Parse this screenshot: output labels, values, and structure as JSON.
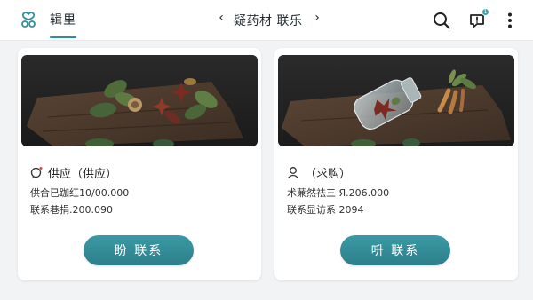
{
  "app": {
    "tab_label": "辑里",
    "accent": "#2f8f9a"
  },
  "nav": {
    "prev_symbol": "‹",
    "title": "疑药材 联乐",
    "next_symbol": "›"
  },
  "toolbar": {
    "search_icon": "search-icon",
    "message_icon": "message-icon",
    "message_badge": "1",
    "more_icon": "more-vertical-icon"
  },
  "cards": [
    {
      "image_icon": "herb-leaves-image",
      "title_icon": "chat-bubble-icon",
      "title": "供应（供应）",
      "line1": "供合已跏红10/00.000",
      "line2": "联系巷捐.200.090",
      "button_label": "盼 联系"
    },
    {
      "image_icon": "herb-jar-roots-image",
      "title_icon": "person-icon",
      "title": "（求购）",
      "line1": "术蒹然祛三 Я.206.000",
      "line2": "联系显访系 2094",
      "button_label": "呏 联系"
    }
  ]
}
